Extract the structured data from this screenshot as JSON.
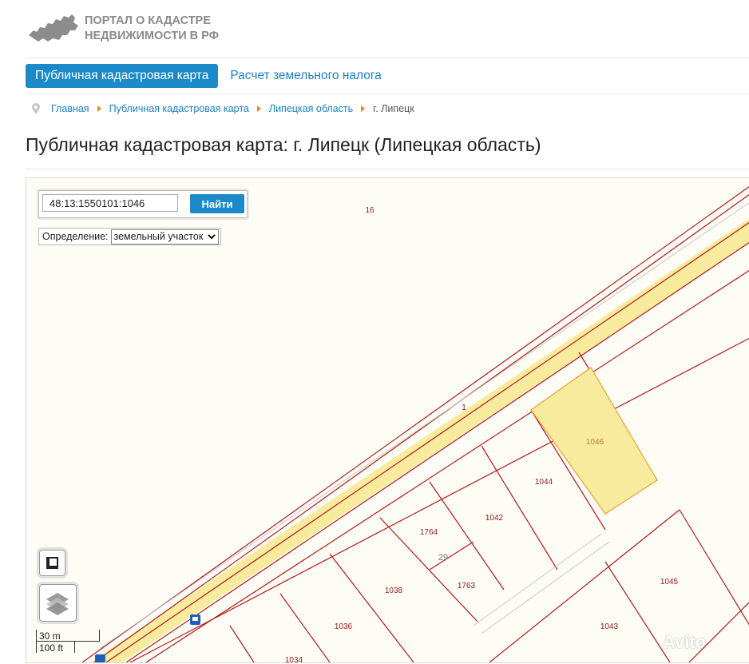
{
  "header": {
    "logo_line1": "ПОРТАЛ О КАДАСТРЕ",
    "logo_line2": "НЕДВИЖИМОСТИ В РФ"
  },
  "nav": {
    "tabs": [
      {
        "label": "Публичная кадастровая карта",
        "active": true
      },
      {
        "label": "Расчет земельного налога",
        "active": false
      }
    ]
  },
  "breadcrumbs": [
    "Главная",
    "Публичная кадастровая карта",
    "Липецкая область",
    "г. Липецк"
  ],
  "page_title": "Публичная кадастровая карта: г. Липецк (Липецкая область)",
  "map": {
    "search": {
      "value": "48:13:1550101:1046",
      "button_label": "Найти"
    },
    "definition": {
      "label": "Определение:",
      "selected": "земельный участок"
    },
    "parcels": [
      "16",
      "1",
      "1046",
      "1044",
      "1042",
      "1764",
      "29",
      "1763",
      "1038",
      "1036",
      "1045",
      "1043",
      "1034"
    ],
    "scale": {
      "metric": "30 m",
      "imperial": "100 ft"
    },
    "highlight_color": "#f9eb9e",
    "line_color": "#b0181e"
  },
  "watermark": "Avito"
}
